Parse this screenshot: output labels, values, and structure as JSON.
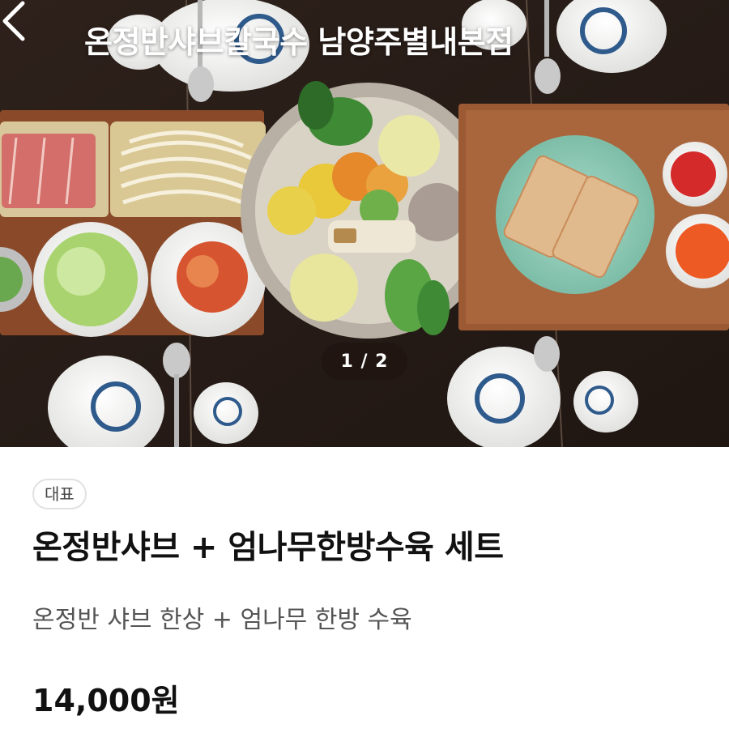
{
  "header": {
    "store_name": "온정반샤브칼국수 남양주별내본점",
    "back_icon": "chevron-left-icon"
  },
  "gallery": {
    "pager": "1 / 2",
    "current_image": 1,
    "total_images": 2
  },
  "menu": {
    "badge": "대표",
    "name": "온정반샤브 + 엄나무한방수육 세트",
    "description": "온정반 샤브 한상 + 엄나무 한방 수육",
    "price": "14,000원"
  },
  "colors": {
    "table": "#2a1d17",
    "tray": "#8a4a2a",
    "bowl": "#f4f4f2",
    "celadon": "#8fcbb6",
    "pattern_blue": "#2e5a8c"
  }
}
